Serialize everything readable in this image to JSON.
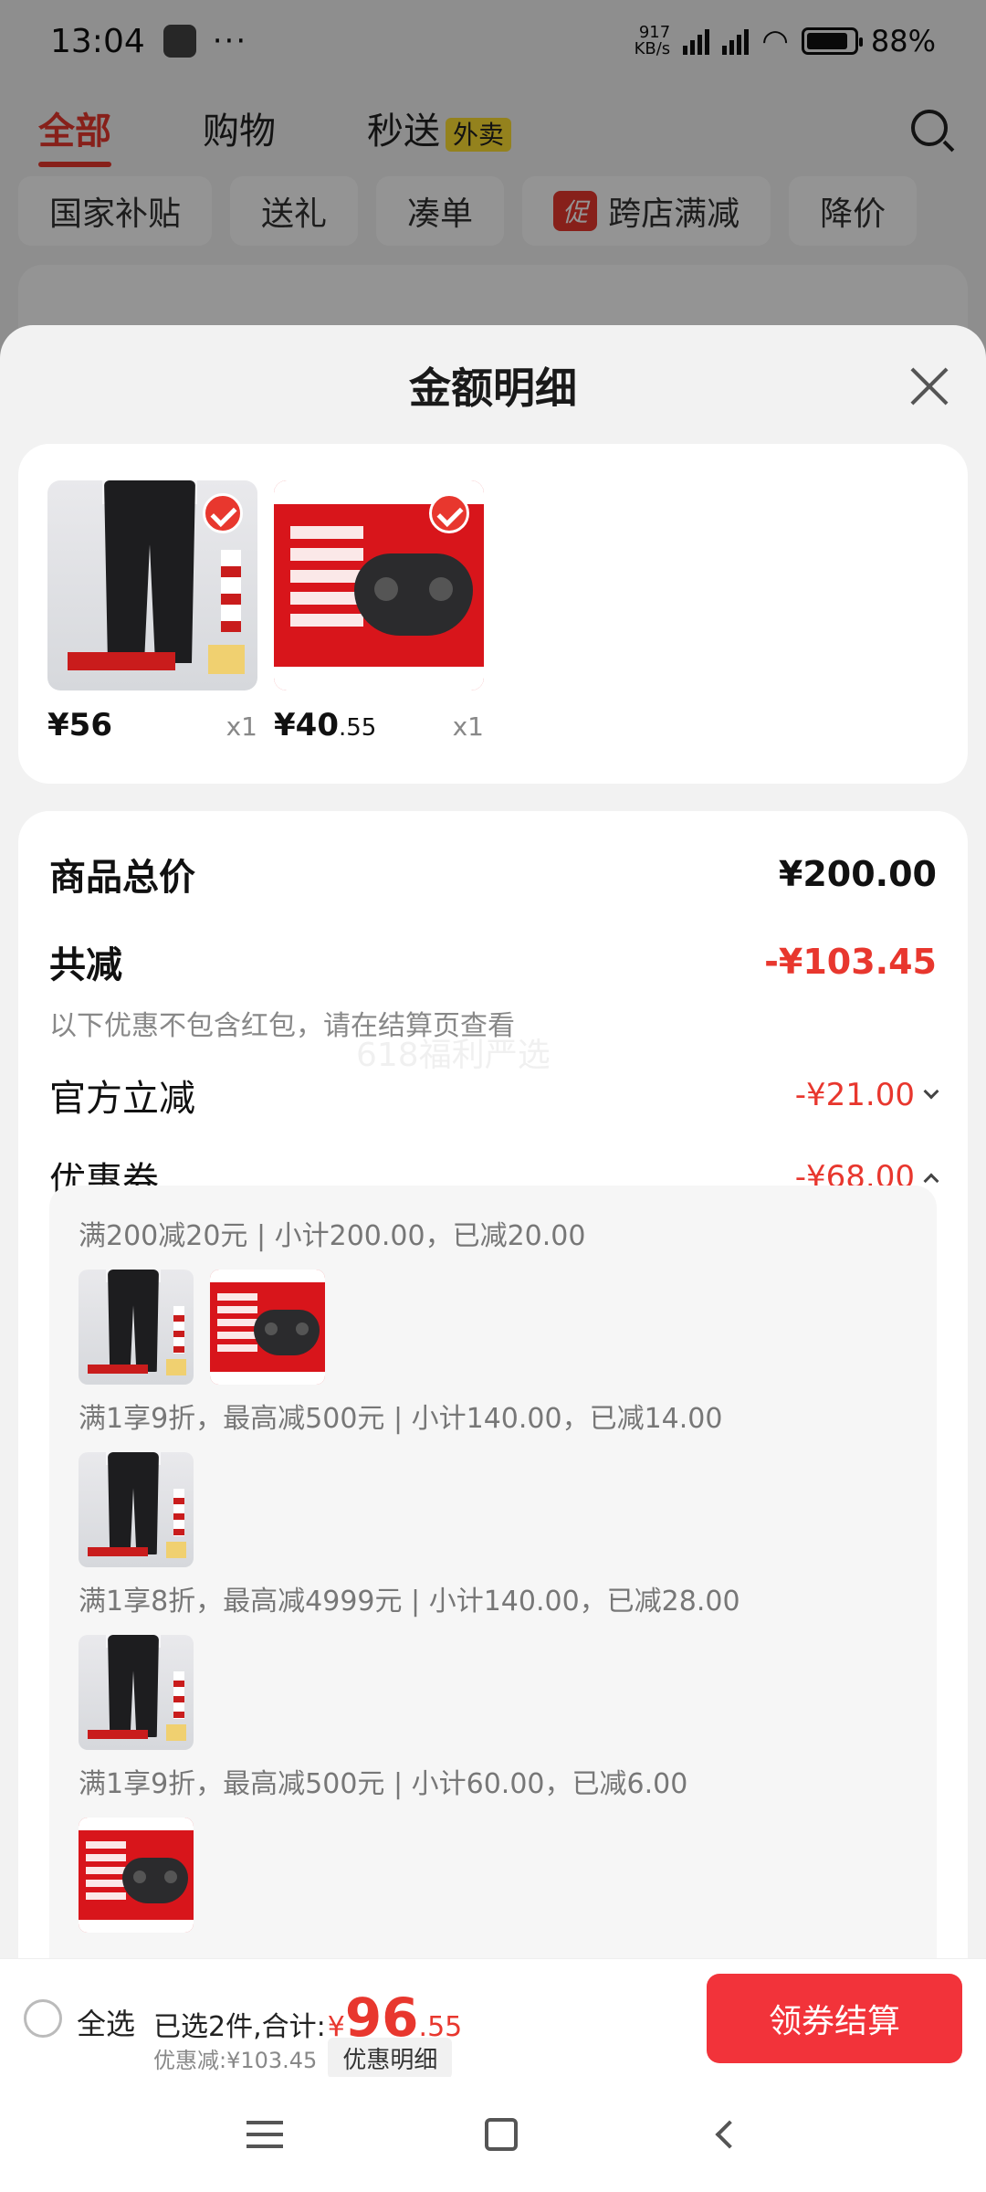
{
  "status_bar": {
    "time": "13:04",
    "dots": "···",
    "net_speed": "917\nKB/s",
    "battery": "88%"
  },
  "top_tabs": [
    {
      "label": "全部"
    },
    {
      "label": "购物"
    },
    {
      "label": "秒送",
      "badge": "外卖"
    }
  ],
  "chips": [
    {
      "label": "国家补贴"
    },
    {
      "label": "送礼"
    },
    {
      "label": "凑单"
    },
    {
      "label": "跨店满减",
      "promo": "促"
    },
    {
      "label": "降价"
    }
  ],
  "sheet": {
    "title": "金额明细",
    "products": [
      {
        "price_main": "¥56",
        "price_dec": "",
        "qty": "x1"
      },
      {
        "price_main": "¥40",
        "price_dec": ".55",
        "qty": "x1"
      }
    ],
    "total_label": "商品总价",
    "total_value": "¥200.00",
    "reduce_label": "共减",
    "reduce_value": "-¥103.45",
    "note": "以下优惠不包含红包，请在结算页查看",
    "watermark": "618福利严选",
    "official_label": "官方立减",
    "official_value": "-¥21.00",
    "coupon_label": "优惠券",
    "coupon_value": "-¥68.00",
    "coupon_lines": [
      "满200减20元 | 小计200.00，已减20.00",
      "满1享9折，最高减500元 | 小计140.00，已减14.00",
      "满1享8折，最高减4999元 | 小计140.00，已减28.00",
      "满1享9折，最高减500元 | 小计60.00，已减6.00"
    ]
  },
  "bottom_bar": {
    "select_all": "全选",
    "selected_text": "已选2件,合计:",
    "currency": "¥",
    "total_big": "96",
    "total_dec": ".55",
    "saving": "优惠减:¥103.45",
    "detail_button": "优惠明细",
    "checkout_button": "领券结算"
  },
  "colors": {
    "accent": "#e8372e",
    "checkout": "#f2333a"
  }
}
